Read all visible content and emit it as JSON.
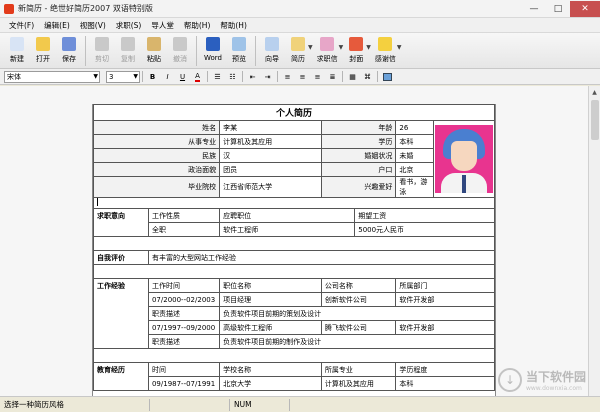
{
  "window": {
    "title": "新简历 - 绝世好简历2007 双语特别版"
  },
  "window_controls": {
    "minimize": "—",
    "maximize": "□",
    "close": "✕"
  },
  "menu": [
    "文件(F)",
    "编辑(E)",
    "视图(V)",
    "求职(S)",
    "导人堂",
    "帮助(H)",
    "帮助(H)"
  ],
  "toolbar": [
    {
      "label": "新建",
      "icon": "new-document-icon",
      "color": "#d8e4f5",
      "enabled": true,
      "sep_after": false,
      "dropdown": false
    },
    {
      "label": "打开",
      "icon": "open-folder-icon",
      "color": "#f2c94c",
      "enabled": true,
      "sep_after": false,
      "dropdown": false
    },
    {
      "label": "保存",
      "icon": "save-disk-icon",
      "color": "#6f8fd9",
      "enabled": true,
      "sep_after": true,
      "dropdown": false
    },
    {
      "label": "剪切",
      "icon": "cut-icon",
      "color": "#c9c9c9",
      "enabled": false,
      "sep_after": false,
      "dropdown": false
    },
    {
      "label": "复制",
      "icon": "copy-icon",
      "color": "#c9c9c9",
      "enabled": false,
      "sep_after": false,
      "dropdown": false
    },
    {
      "label": "粘贴",
      "icon": "paste-icon",
      "color": "#d9b56c",
      "enabled": true,
      "sep_after": false,
      "dropdown": false
    },
    {
      "label": "撤消",
      "icon": "undo-icon",
      "color": "#c9c9c9",
      "enabled": false,
      "sep_after": true,
      "dropdown": false
    },
    {
      "label": "Word",
      "icon": "word-icon",
      "color": "#2b5fbf",
      "enabled": true,
      "sep_after": false,
      "dropdown": false
    },
    {
      "label": "预览",
      "icon": "preview-icon",
      "color": "#9fc3e8",
      "enabled": true,
      "sep_after": true,
      "dropdown": false
    },
    {
      "label": "向导",
      "icon": "wizard-icon",
      "color": "#b8d0ee",
      "enabled": true,
      "sep_after": false,
      "dropdown": false
    },
    {
      "label": "简历",
      "icon": "resume-icon",
      "color": "#f0d27a",
      "enabled": true,
      "sep_after": false,
      "dropdown": true
    },
    {
      "label": "求职信",
      "icon": "letter-icon",
      "color": "#e7a6c8",
      "enabled": true,
      "sep_after": false,
      "dropdown": true
    },
    {
      "label": "封面",
      "icon": "cover-icon",
      "color": "#e65a3c",
      "enabled": true,
      "sep_after": false,
      "dropdown": true
    },
    {
      "label": "感谢信",
      "icon": "smiley-icon",
      "color": "#f4d03f",
      "enabled": true,
      "sep_after": false,
      "dropdown": true
    }
  ],
  "format": {
    "font": "宋体",
    "size": "3",
    "bold": "B",
    "italic": "I",
    "underline": "U"
  },
  "resume": {
    "title": "个人简历",
    "basic": [
      [
        "姓名",
        "李某",
        "年龄",
        "26"
      ],
      [
        "从事专业",
        "计算机及其应用",
        "学历",
        "本科"
      ],
      [
        "民族",
        "汉",
        "婚姻状况",
        "未婚"
      ],
      [
        "政治面貌",
        "团员",
        "户口",
        "北京"
      ],
      [
        "毕业院校",
        "江西省师范大学",
        "兴趣爱好",
        "看书，游泳"
      ]
    ],
    "intent": {
      "section": "求职意向",
      "headers": [
        "工作性质",
        "应聘职位",
        "期望工资"
      ],
      "row": [
        "全职",
        "软件工程师",
        "5000元人民币"
      ]
    },
    "self": {
      "section": "自我评价",
      "text": "有丰富的大型网站工作经验"
    },
    "experience": {
      "section": "工作经验",
      "headers": [
        "工作时间",
        "职位名称",
        "公司名称",
        "所属部门"
      ],
      "jobs": [
        {
          "time": "07/2000--02/2003",
          "title": "项目经理",
          "company": "创新软件公司",
          "dept": "软件开发部",
          "desc_label": "职责描述",
          "desc": "负责软件项目前期的策划及设计"
        },
        {
          "time": "07/1997--09/2000",
          "title": "高级软件工程师",
          "company": "腾飞软件公司",
          "dept": "软件开发部",
          "desc_label": "职责描述",
          "desc": "负责软件项目前期的制作及设计"
        }
      ]
    },
    "education": {
      "section": "教育经历",
      "headers": [
        "时间",
        "学校名称",
        "所属专业",
        "学历程度"
      ],
      "row": [
        "09/1987--07/1991",
        "北京大学",
        "计算机及其应用",
        "本科"
      ]
    }
  },
  "status": {
    "hint": "选择一种简历风格",
    "num": "NUM"
  },
  "watermark": {
    "cn": "当下软件园",
    "en": "www.downxia.com"
  }
}
